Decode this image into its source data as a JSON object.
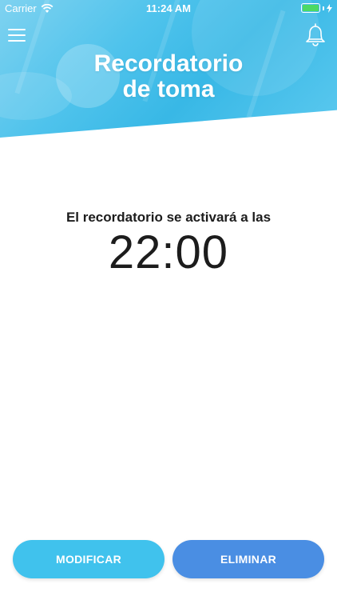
{
  "status_bar": {
    "carrier": "Carrier",
    "time": "11:24 AM",
    "battery_level": 1.0,
    "battery_color": "#4cd964"
  },
  "header": {
    "title_line1": "Recordatorio",
    "title_line2": "de toma",
    "menu_icon": "hamburger-menu-icon",
    "bell_icon": "bell-icon",
    "accent": "#40c2ed"
  },
  "reminder": {
    "label": "El recordatorio se activará a las",
    "time": "22:00"
  },
  "actions": {
    "modify_label": "MODIFICAR",
    "modify_color": "#40c2ed",
    "delete_label": "ELIMINAR",
    "delete_color": "#4a8ee3"
  }
}
